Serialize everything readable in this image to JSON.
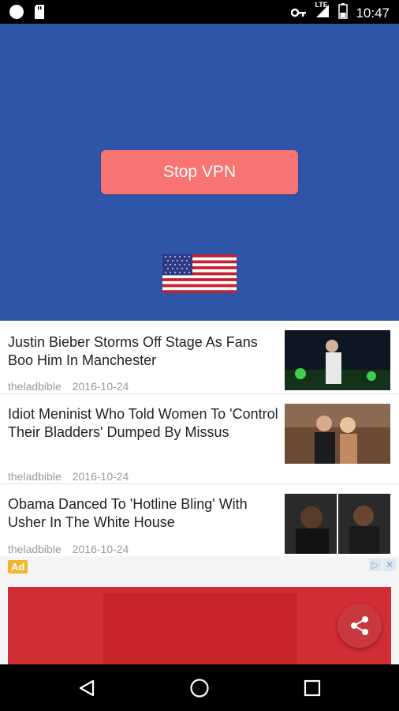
{
  "status_bar": {
    "time": "10:47",
    "network": "LTE",
    "icons": [
      "cloud-icon",
      "sd-card-icon",
      "key-icon",
      "signal-icon",
      "battery-icon"
    ]
  },
  "vpn": {
    "button_label": "Stop VPN",
    "country_flag": "us-flag-icon",
    "colors": {
      "background": "#2e55a7",
      "button": "#f77472"
    }
  },
  "news": [
    {
      "title": "Justin Bieber Storms Off Stage As Fans Boo Him In Manchester",
      "source": "theladbible",
      "date": "2016-10-24"
    },
    {
      "title": "Idiot Meninist Who Told Women To 'Control Their Bladders' Dumped By Missus",
      "source": "theladbible",
      "date": "2016-10-24"
    },
    {
      "title": "Obama Danced To 'Hotline Bling' With Usher In The White House",
      "source": "theladbible",
      "date": "2016-10-24"
    }
  ],
  "ad": {
    "badge": "Ad",
    "choices_icons": [
      "ad-choices-icon",
      "close-icon"
    ]
  },
  "nav": {
    "icons": [
      "back-icon",
      "home-icon",
      "recents-icon"
    ]
  }
}
